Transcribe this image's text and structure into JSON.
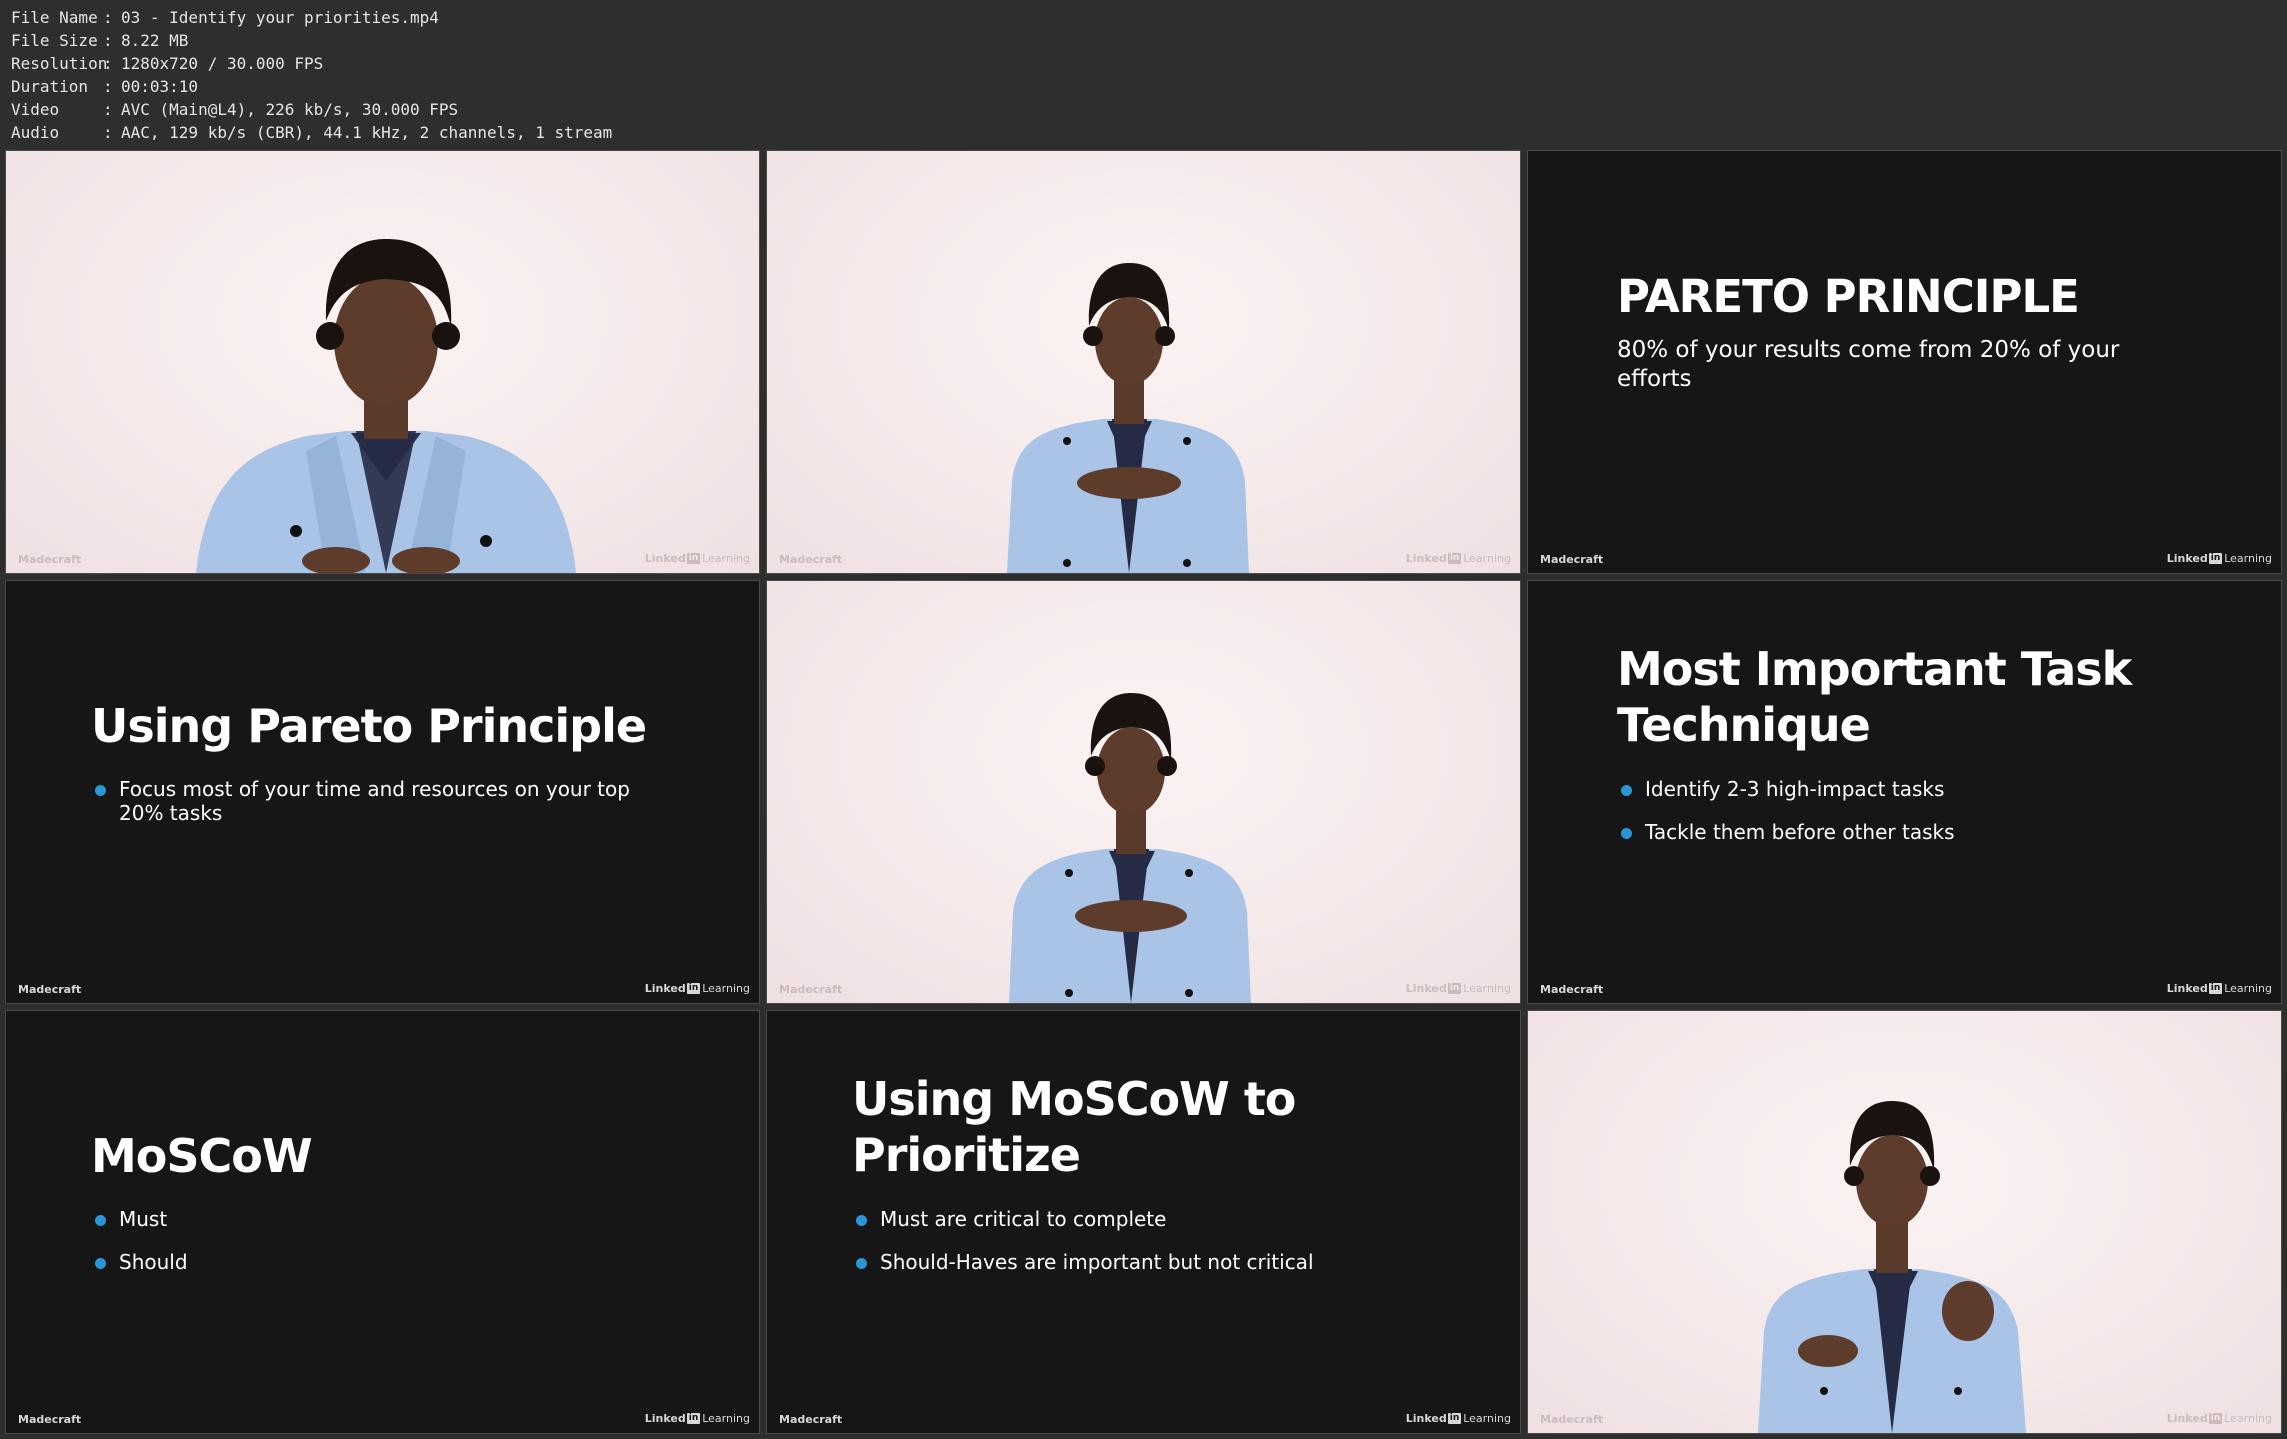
{
  "file_info": [
    {
      "key": "File Name",
      "value": "03 - Identify your priorities.mp4"
    },
    {
      "key": "File Size",
      "value": "8.22 MB"
    },
    {
      "key": "Resolution",
      "value": "1280x720 / 30.000 FPS"
    },
    {
      "key": "Duration",
      "value": "00:03:10"
    },
    {
      "key": "Video",
      "value": "AVC (Main@L4), 226 kb/s, 30.000 FPS"
    },
    {
      "key": "Audio",
      "value": "AAC, 129 kb/s (CBR), 44.1 kHz, 2 channels, 1 stream"
    }
  ],
  "branding": {
    "studio": "Madecraft",
    "logo_linked": "Linked",
    "logo_in": "in",
    "logo_learning": "Learning"
  },
  "slides": {
    "pareto": {
      "title": "PARETO PRINCIPLE",
      "subtitle": "80% of your results come from 20% of your efforts"
    },
    "using_pareto": {
      "title": "Using Pareto Principle",
      "bullets": [
        "Focus most of your time and resources on your top 20% tasks"
      ]
    },
    "mit": {
      "title": "Most Important Task Technique",
      "bullets": [
        "Identify 2-3 high-impact tasks",
        "Tackle them before other tasks"
      ]
    },
    "moscow": {
      "title": "MoSCoW",
      "bullets": [
        "Must",
        "Should"
      ]
    },
    "using_moscow": {
      "title": "Using MoSCoW to Prioritize",
      "bullets": [
        "Must are critical to complete",
        "Should-Haves are important but not critical"
      ]
    }
  },
  "colors": {
    "dark_slide_bg": "#161617",
    "light_slide_bg": "#f5e9ea",
    "bullet_accent": "#2b96d4",
    "blazer": "#a9c4e6"
  }
}
